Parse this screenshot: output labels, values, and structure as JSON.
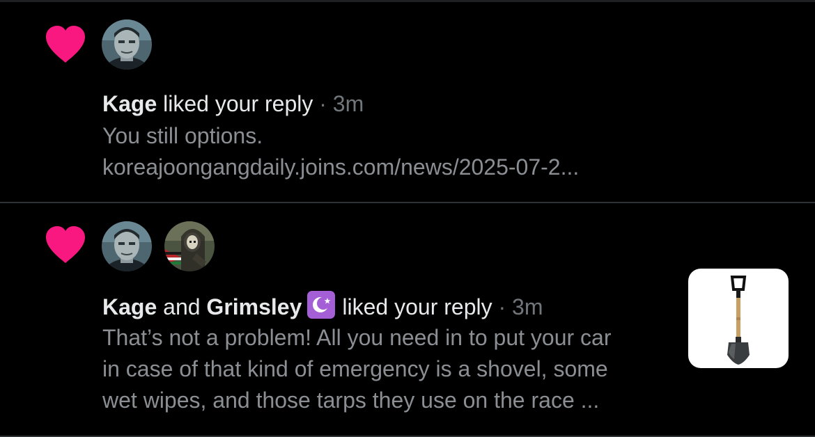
{
  "notifications": [
    {
      "actor1": "Kage",
      "action": "liked your reply",
      "separator": "·",
      "time": "3m",
      "text_line1": "You still options.",
      "text_line2": "koreajoongangdaily.joins.com/news/2025-07-2..."
    },
    {
      "actor1": "Kage",
      "conjunction": "and",
      "actor2": "Grimsley",
      "badge_icon": "star-and-crescent-icon",
      "action": "liked your reply",
      "separator": "·",
      "time": "3m",
      "text_line1": "That’s not a problem! All you need in to put your car",
      "text_line2": "in case of that kind of emergency is a shovel, some",
      "text_line3": "wet wipes, and those tarps they use on the race ...",
      "thumbnail_icon": "shovel-icon"
    }
  ],
  "colors": {
    "background": "#000000",
    "heart": "#f91880",
    "divider": "#2f3336",
    "primary_text": "#e7e9ea",
    "secondary_text": "#71767b",
    "badge": "#a45fd6"
  }
}
